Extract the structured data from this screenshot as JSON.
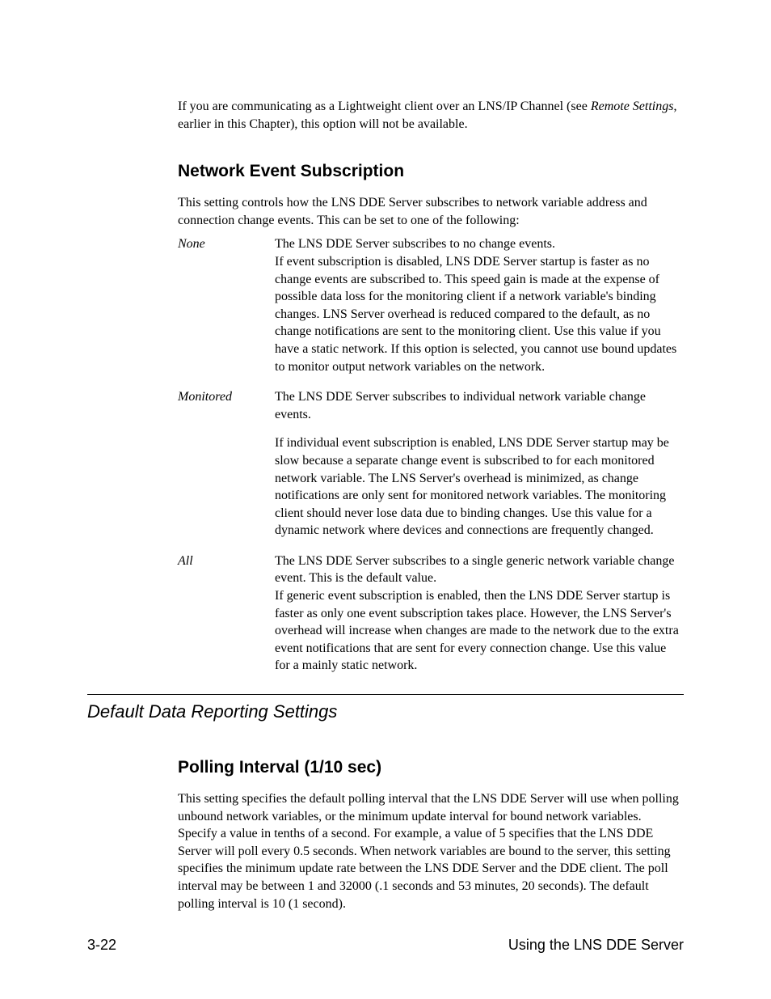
{
  "intro": {
    "prefix": "If you are communicating as a Lightweight client over an LNS/IP Channel (see ",
    "emph": "Remote Settings",
    "suffix": ", earlier in this Chapter), this option will not be available."
  },
  "headings": {
    "nes": "Network Event Subscription",
    "ddrs": "Default Data Reporting Settings",
    "polling": "Polling Interval (1/10 sec)"
  },
  "nes_lead": "This setting controls how the LNS DDE Server subscribes to network variable address and connection change events. This can be set to one of the following:",
  "defs": [
    {
      "term": "None",
      "paras": [
        "The LNS DDE Server subscribes to no change events.",
        "If event subscription is disabled, LNS DDE Server startup is faster as no change events are subscribed to.  This speed gain is made at the expense of possible data loss for the monitoring client if a network variable's binding changes.  LNS Server overhead is reduced compared to the default, as no change notifications are sent to the monitoring client.  Use this value if you have a static network. If this option is selected, you cannot use bound updates to monitor output network variables on the network."
      ]
    },
    {
      "term": "Monitored",
      "paras": [
        "The LNS DDE Server subscribes to individual network variable change events.",
        "If individual event subscription is enabled, LNS DDE Server startup may be slow because a separate change event is subscribed to for each monitored network variable.  The LNS Server's overhead is minimized, as change notifications are only sent for monitored network variables.  The monitoring client should never lose data due to binding changes.  Use this value for a dynamic network where devices and connections are frequently changed."
      ]
    },
    {
      "term": "All",
      "paras": [
        "The LNS DDE Server subscribes to a single generic network variable change event. This is the default value.",
        "If generic event subscription is enabled, then the LNS DDE Server startup is faster as only one event subscription takes place.  However, the LNS Server's overhead will increase when changes are made to the network due to the extra event notifications that are sent for every connection change. Use this value for a mainly static network."
      ]
    }
  ],
  "polling_body": "This setting specifies the default polling interval that the LNS DDE Server will use when polling unbound network variables, or the minimum update interval for bound network variables.  Specify a value in tenths of a second.  For example, a value of 5 specifies that the LNS DDE Server will poll every 0.5 seconds.  When network variables are bound to the server, this setting specifies the minimum update rate between the LNS DDE Server and the DDE client. The poll interval may be between 1 and 32000 (.1 seconds and 53 minutes, 20 seconds). The default polling interval is 10 (1 second).",
  "footer": {
    "page_num": "3-22",
    "chapter": "Using the LNS DDE Server"
  }
}
